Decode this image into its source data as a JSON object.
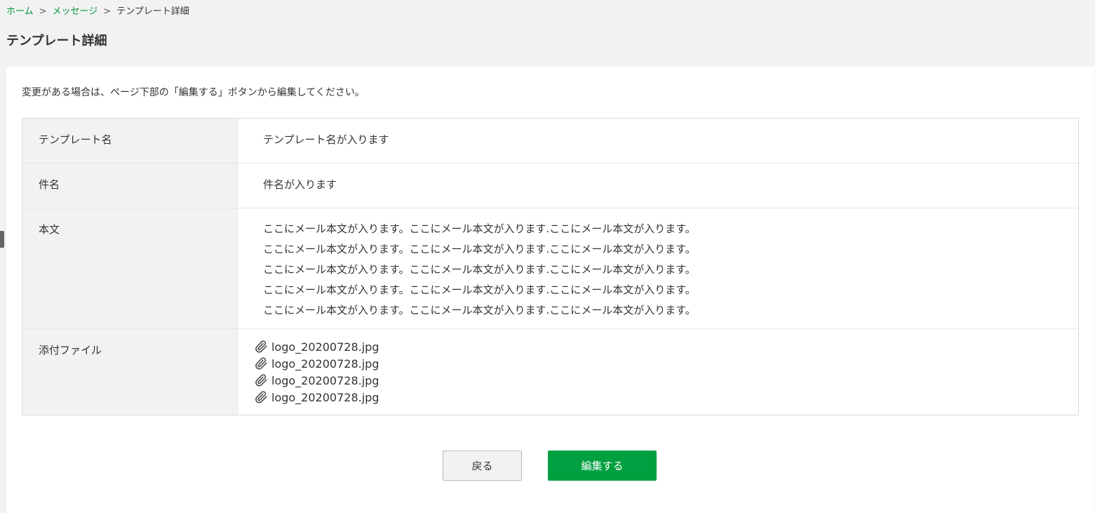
{
  "breadcrumb": {
    "home": "ホーム",
    "separator": ">",
    "messages": "メッセージ",
    "current": "テンプレート詳細"
  },
  "page_title": "テンプレート詳細",
  "notice": "変更がある場合は、ページ下部の「編集する」ボタンから編集してください。",
  "detail": {
    "template_name": {
      "label": "テンプレート名",
      "value": "テンプレート名が入ります"
    },
    "subject": {
      "label": "件名",
      "value": "件名が入ります"
    },
    "body": {
      "label": "本文",
      "lines": [
        "ここにメール本文が入ります。ここにメール本文が入ります.ここにメール本文が入ります。",
        "ここにメール本文が入ります。ここにメール本文が入ります.ここにメール本文が入ります。",
        "ここにメール本文が入ります。ここにメール本文が入ります.ここにメール本文が入ります。",
        "ここにメール本文が入ります。ここにメール本文が入ります.ここにメール本文が入ります。",
        "ここにメール本文が入ります。ここにメール本文が入ります.ここにメール本文が入ります。"
      ]
    },
    "attachments": {
      "label": "添付ファイル",
      "icon": "paperclip-icon",
      "files": [
        "logo_20200728.jpg",
        "logo_20200728.jpg",
        "logo_20200728.jpg",
        "logo_20200728.jpg"
      ]
    }
  },
  "buttons": {
    "back_label": "戻る",
    "edit_label": "編集する"
  },
  "colors": {
    "accent": "#00a040",
    "link": "#00963c",
    "background": "#f2f2f2",
    "label_cell": "#f2f2f2"
  }
}
